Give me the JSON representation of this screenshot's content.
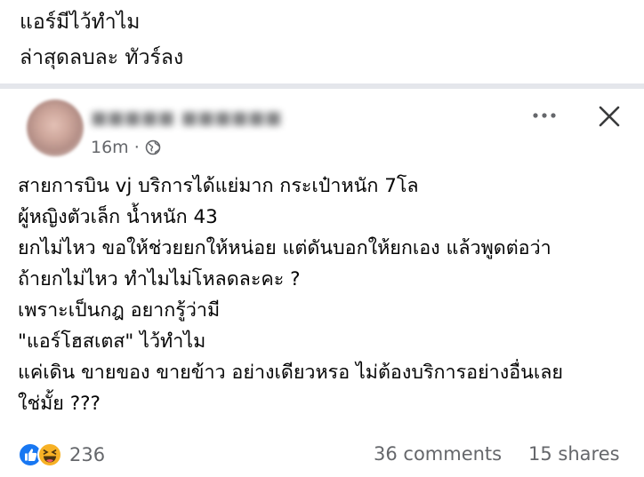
{
  "caption": {
    "line1": "แอร์มีไว้ทำไม",
    "line2": "ล่าสุดลบละ ทัวร์ลง"
  },
  "post": {
    "author": "■■■■■ ■■■■■■",
    "time": "16m",
    "separator": "·",
    "privacy_icon": "globe-icon",
    "more_icon": "more-dots-icon",
    "close_icon": "close-icon",
    "body": [
      "สายการบิน vj บริการได้แย่มาก กระเป๋าหนัก 7โล",
      "ผู้หญิงตัวเล็ก น้ำหนัก 43",
      "ยกไม่ไหว ขอให้ช่วยยกให้หน่อย แต่ดันบอกให้ยกเอง แล้วพูดต่อว่า",
      "ถ้ายกไม่ไหว ทำไมไม่โหลดละคะ ?",
      "เพราะเป็นกฎ อยากรู้ว่ามี",
      "\"แอร์โฮสเตส\" ไว้ทำไม",
      "แค่เดิน ขายของ ขายข้าว อย่างเดียวหรอ ไม่ต้องบริการอย่างอื่นเลย",
      "ใช่มั้ย ???"
    ]
  },
  "footer": {
    "reaction_icons": [
      "like-icon",
      "haha-icon"
    ],
    "reaction_count": "236",
    "comments": "36 comments",
    "shares": "15 shares"
  },
  "colors": {
    "like_blue": "#1877f2",
    "haha_yellow": "#f7b125",
    "meta_gray": "#65676b",
    "divider": "#e4e6eb"
  }
}
